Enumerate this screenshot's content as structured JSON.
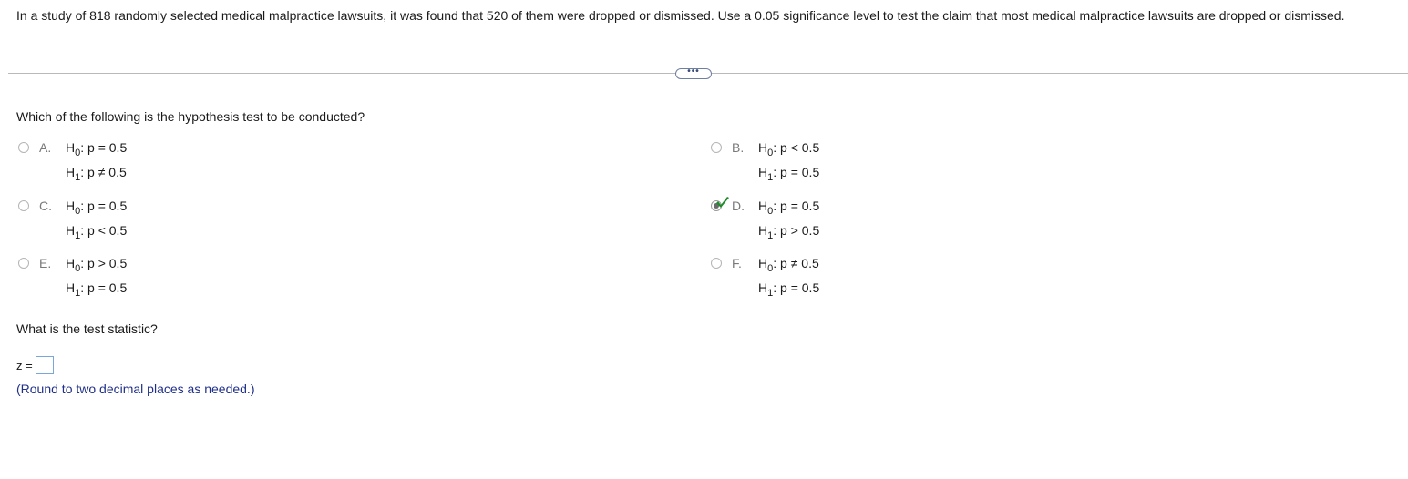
{
  "problem_text": "In a study of 818 randomly selected medical malpractice lawsuits, it was found that 520 of them were dropped or dismissed. Use a 0.05 significance level to test the claim that most medical malpractice lawsuits are dropped or dismissed.",
  "more_button_label": "•••",
  "question1": {
    "prompt": "Which of the following is the hypothesis test to be conducted?",
    "options": [
      {
        "letter": "A.",
        "h0_label": "H",
        "h0_sub": "0",
        "h0_rest": ": p = 0.5",
        "h1_label": "H",
        "h1_sub": "1",
        "h1_rest": ": p ≠ 0.5",
        "selected": false
      },
      {
        "letter": "B.",
        "h0_label": "H",
        "h0_sub": "0",
        "h0_rest": ": p < 0.5",
        "h1_label": "H",
        "h1_sub": "1",
        "h1_rest": ": p = 0.5",
        "selected": false
      },
      {
        "letter": "C.",
        "h0_label": "H",
        "h0_sub": "0",
        "h0_rest": ": p = 0.5",
        "h1_label": "H",
        "h1_sub": "1",
        "h1_rest": ": p < 0.5",
        "selected": false
      },
      {
        "letter": "D.",
        "h0_label": "H",
        "h0_sub": "0",
        "h0_rest": ": p = 0.5",
        "h1_label": "H",
        "h1_sub": "1",
        "h1_rest": ": p > 0.5",
        "selected": true
      },
      {
        "letter": "E.",
        "h0_label": "H",
        "h0_sub": "0",
        "h0_rest": ": p > 0.5",
        "h1_label": "H",
        "h1_sub": "1",
        "h1_rest": ": p = 0.5",
        "selected": false
      },
      {
        "letter": "F.",
        "h0_label": "H",
        "h0_sub": "0",
        "h0_rest": ": p ≠ 0.5",
        "h1_label": "H",
        "h1_sub": "1",
        "h1_rest": ": p = 0.5",
        "selected": false
      }
    ],
    "correct_indicator": "check-icon",
    "check_color": "#1e8c2a"
  },
  "question2": {
    "prompt": "What is the test statistic?",
    "z_label": "z =",
    "z_value": "",
    "note": "(Round to two decimal places as needed.)",
    "note_color": "#1f2f8a"
  }
}
